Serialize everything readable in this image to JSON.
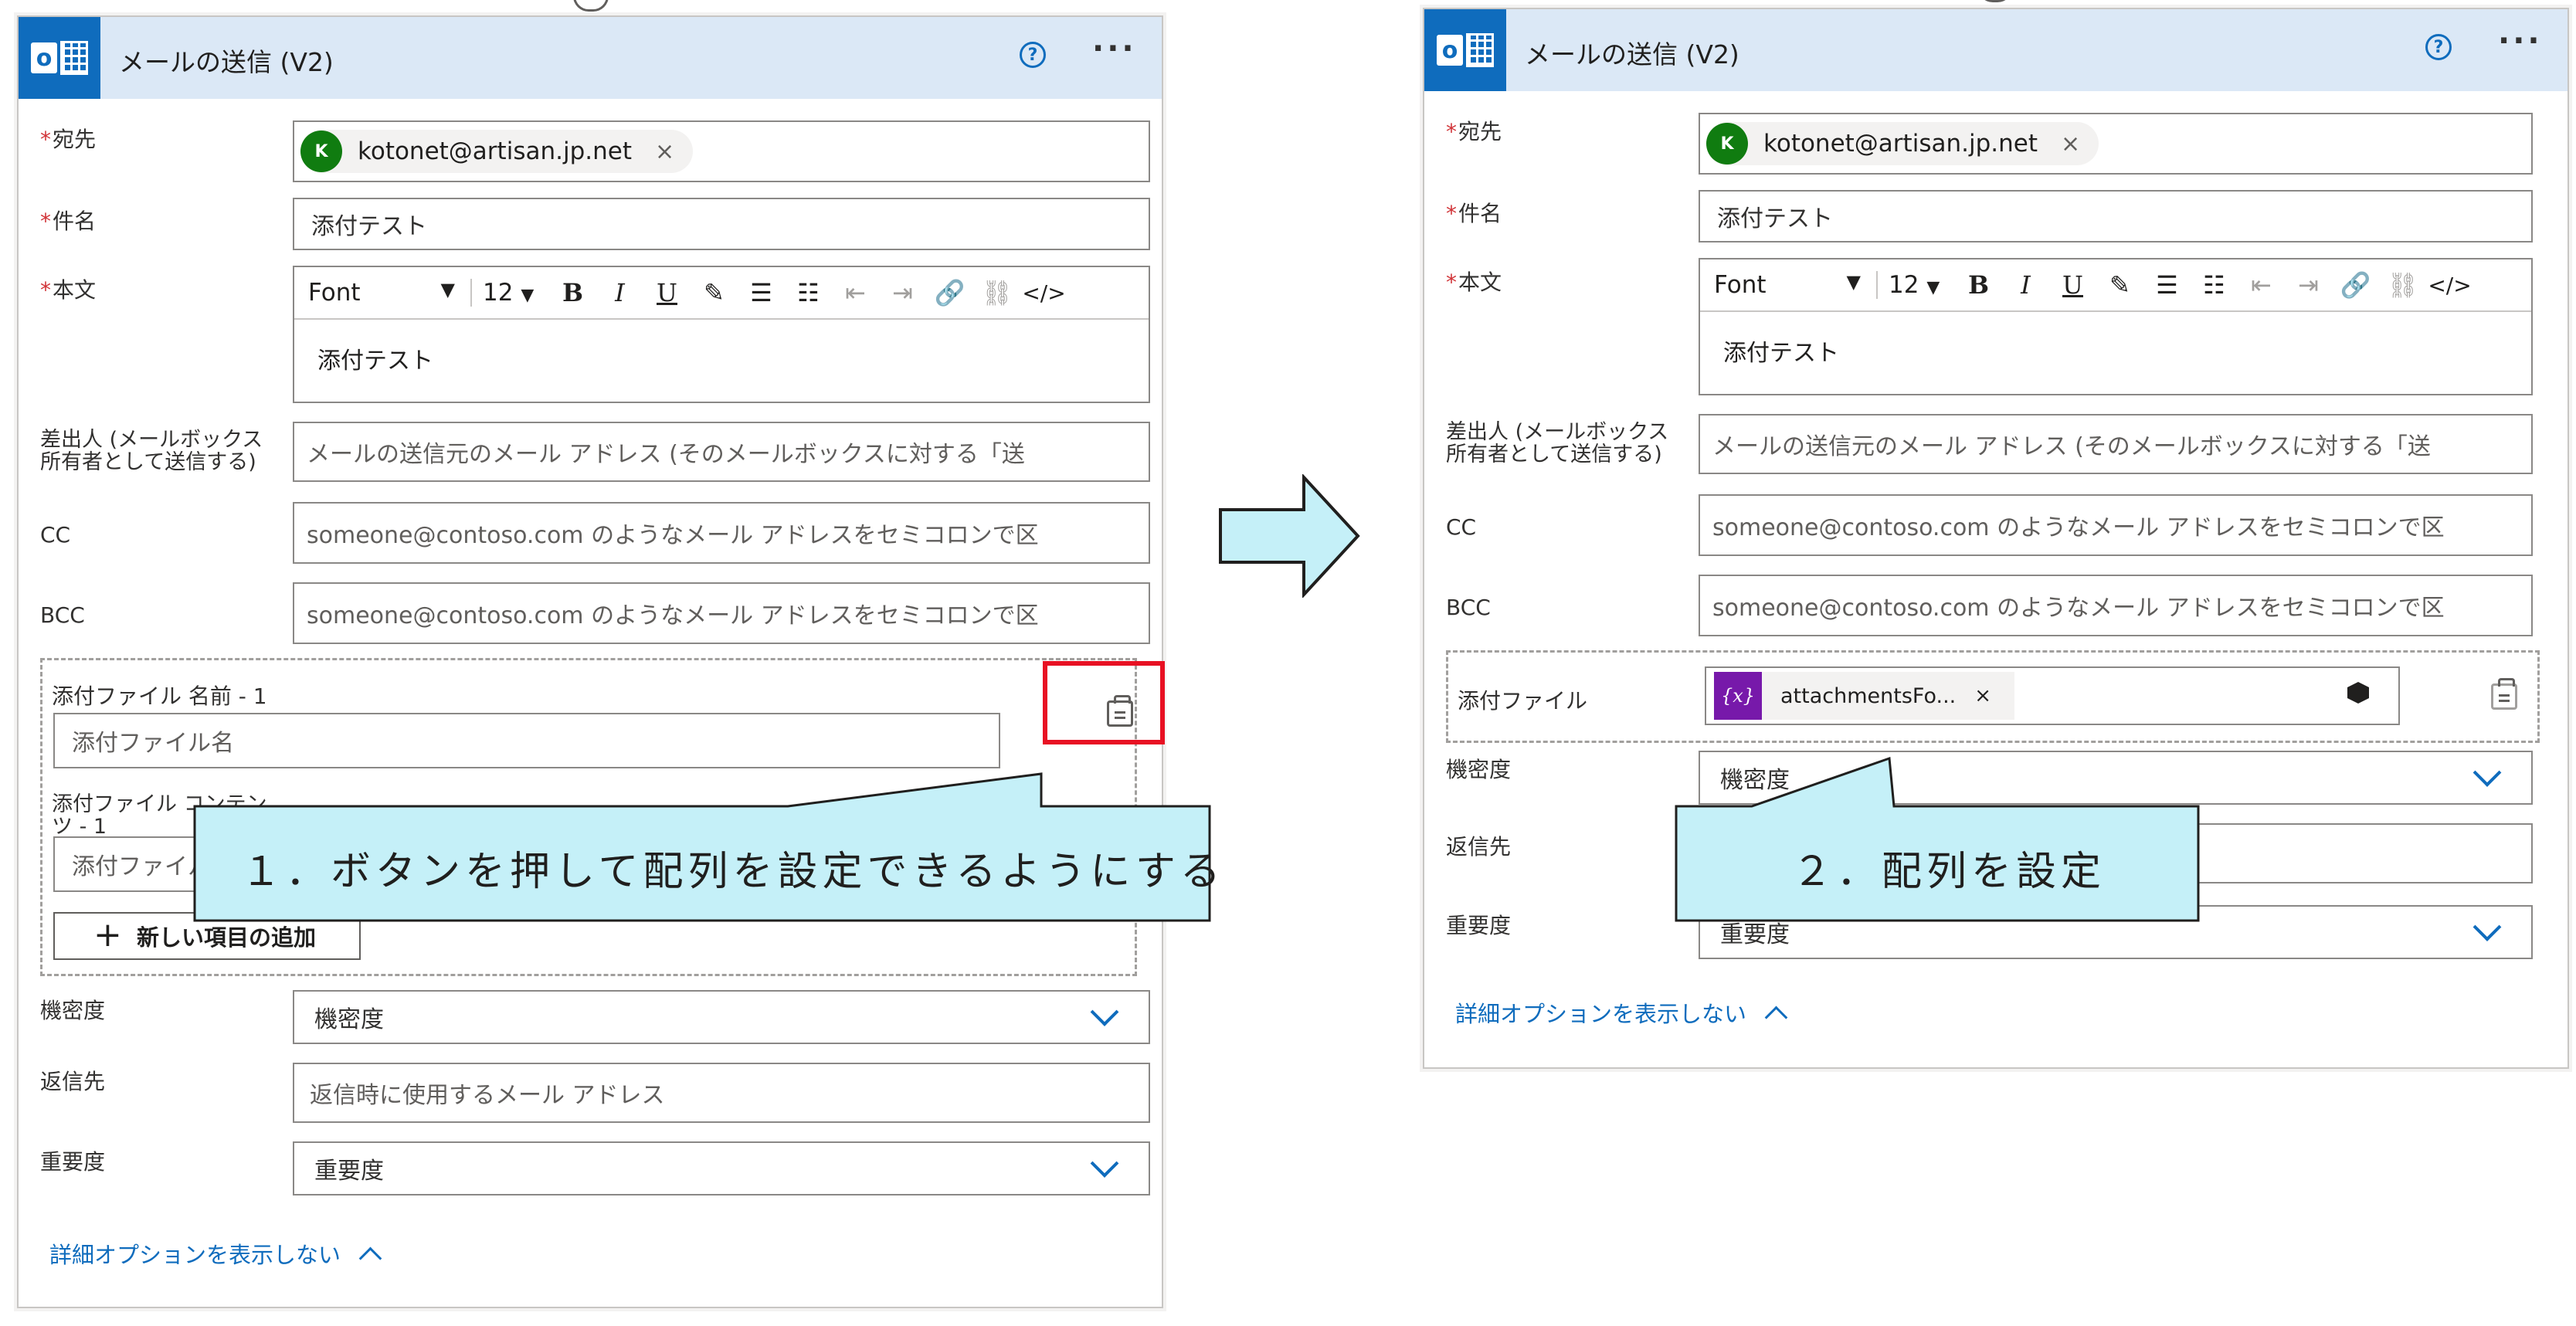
{
  "colors": {
    "accent": "#0f6cbd",
    "header_bg": "#dbe8f6",
    "required": "#d13438",
    "callout_fill": "#c5f0f8",
    "highlight": "#e81123",
    "expr_token": "#7719aa"
  },
  "left": {
    "title": "メールの送信 (V2)",
    "help_icon": "?",
    "more_icon": "···",
    "to": {
      "label": "宛先",
      "required_mark": "*",
      "avatar": "K",
      "email": "kotonet@artisan.jp.net",
      "remove": "×"
    },
    "subject": {
      "label": "件名",
      "required_mark": "*",
      "value": "添付テスト"
    },
    "body": {
      "label": "本文",
      "required_mark": "*",
      "font": "Font",
      "font_caret": "▼",
      "size": "12",
      "size_caret": "▼",
      "value": "添付テスト",
      "toolbar": [
        "B",
        "I",
        "U",
        "✎",
        "☰",
        "☷",
        "⇤",
        "⇥",
        "🔗",
        "⛓",
        "</>"
      ]
    },
    "from": {
      "label_line1": "差出人 (メールボックス",
      "label_line2": "所有者として送信する)",
      "placeholder": "メールの送信元のメール アドレス (そのメールボックスに対する「送"
    },
    "cc": {
      "label": "CC",
      "placeholder": "someone@contoso.com のようなメール アドレスをセミコロンで区"
    },
    "bcc": {
      "label": "BCC",
      "placeholder": "someone@contoso.com のようなメール アドレスをセミコロンで区"
    },
    "attachments": {
      "name_label": "添付ファイル 名前 - 1",
      "name_placeholder": "添付ファイル名",
      "content_label_line1": "添付ファイル コンテン",
      "content_label_line2": "ツ - 1",
      "content_placeholder": "添付ファイル",
      "add_item": "新しい項目の追加",
      "add_plus": "+"
    },
    "sensitivity": {
      "label": "機密度",
      "value": "機密度"
    },
    "reply_to": {
      "label": "返信先",
      "placeholder": "返信時に使用するメール アドレス"
    },
    "importance": {
      "label": "重要度",
      "value": "重要度"
    },
    "advanced_link": "詳細オプションを表示しない"
  },
  "right": {
    "title": "メールの送信 (V2)",
    "help_icon": "?",
    "more_icon": "···",
    "to": {
      "label": "宛先",
      "required_mark": "*",
      "avatar": "K",
      "email": "kotonet@artisan.jp.net",
      "remove": "×"
    },
    "subject": {
      "label": "件名",
      "required_mark": "*",
      "value": "添付テスト"
    },
    "body": {
      "label": "本文",
      "required_mark": "*",
      "font": "Font",
      "font_caret": "▼",
      "size": "12",
      "size_caret": "▼",
      "value": "添付テスト",
      "toolbar": [
        "B",
        "I",
        "U",
        "✎",
        "☰",
        "☷",
        "⇤",
        "⇥",
        "🔗",
        "⛓",
        "</>"
      ]
    },
    "from": {
      "label_line1": "差出人 (メールボックス",
      "label_line2": "所有者として送信する)",
      "placeholder": "メールの送信元のメール アドレス (そのメールボックスに対する「送"
    },
    "cc": {
      "label": "CC",
      "placeholder": "someone@contoso.com のようなメール アドレスをセミコロンで区"
    },
    "bcc": {
      "label": "BCC",
      "placeholder": "someone@contoso.com のようなメール アドレスをセミコロンで区"
    },
    "attachments": {
      "label": "添付ファイル",
      "token_icon": "{x}",
      "token_text": "attachmentsFo...",
      "token_remove": "×"
    },
    "sensitivity": {
      "label": "機密度",
      "value": "機密度"
    },
    "reply_to": {
      "label": "返信先"
    },
    "importance": {
      "label": "重要度",
      "value": "重要度"
    },
    "advanced_link": "詳細オプションを表示しない"
  },
  "callouts": {
    "step1": "１．ボタンを押して配列を設定できるようにする",
    "step2": "２．配列を設定"
  }
}
